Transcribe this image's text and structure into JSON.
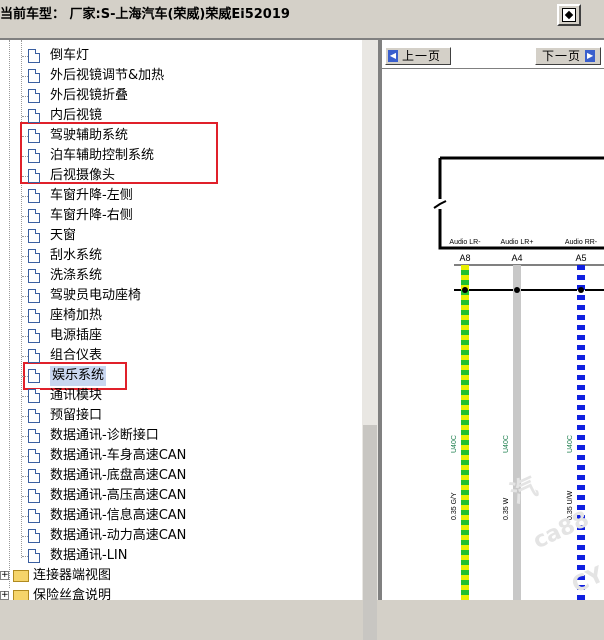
{
  "header": {
    "title": "当前车型： 厂家:S-上海汽车(荣威)荣威Ei52019"
  },
  "tree": {
    "items": [
      "倒车灯",
      "外后视镜调节&加热",
      "外后视镜折叠",
      "内后视镜",
      "驾驶辅助系统",
      "泊车辅助控制系统",
      "后视摄像头",
      "车窗升降-左侧",
      "车窗升降-右侧",
      "天窗",
      "刮水系统",
      "洗涤系统",
      "驾驶员电动座椅",
      "座椅加热",
      "电源插座",
      "组合仪表",
      "娱乐系统",
      "通讯模块",
      "预留接口",
      "数据通讯-诊断接口",
      "数据通讯-车身高速CAN",
      "数据通讯-底盘高速CAN",
      "数据通讯-高压高速CAN",
      "数据通讯-信息高速CAN",
      "数据通讯-动力高速CAN",
      "数据通讯-LIN"
    ],
    "selected": "娱乐系统",
    "folders": [
      "连接器端视图",
      "保险丝盒说明"
    ]
  },
  "diagram": {
    "prev_label": "上一页",
    "next_label": "下一页",
    "pins": [
      {
        "name": "Audio LR-",
        "pin": "A8",
        "wire": "0.35 G/Y",
        "connector": "U40C",
        "colors": [
          "#e8f000",
          "#20c030"
        ]
      },
      {
        "name": "Audio LR+",
        "pin": "A4",
        "wire": "0.35 W",
        "connector": "U40C",
        "colors": [
          "#c8c8c8"
        ]
      },
      {
        "name": "Audio RR-",
        "pin": "A5",
        "wire": "0.35 U/W",
        "connector": "U40C",
        "colors": [
          "#1020e0",
          "#ffffff"
        ]
      }
    ]
  }
}
